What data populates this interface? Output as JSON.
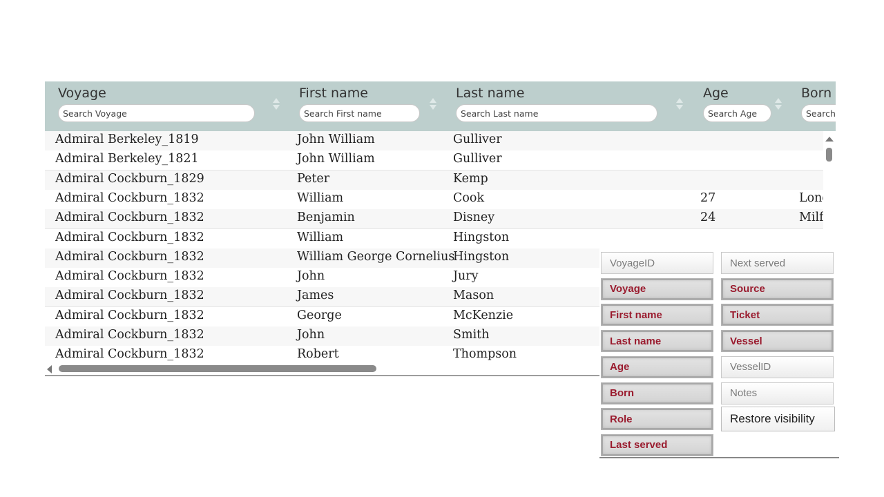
{
  "table": {
    "columns": [
      {
        "label": "Voyage",
        "placeholder": "Search Voyage"
      },
      {
        "label": "First name",
        "placeholder": "Search First name"
      },
      {
        "label": "Last name",
        "placeholder": "Search Last name"
      },
      {
        "label": "Age",
        "placeholder": "Search Age"
      },
      {
        "label": "Born",
        "placeholder": "Search Born"
      }
    ],
    "rows": [
      {
        "voyage": "Admiral Berkeley_1819",
        "first": "John William",
        "last": "Gulliver",
        "age": "",
        "born": ""
      },
      {
        "voyage": "Admiral Berkeley_1821",
        "first": "John William",
        "last": "Gulliver",
        "age": "",
        "born": ""
      },
      {
        "voyage": "Admiral Cockburn_1829",
        "first": "Peter",
        "last": "Kemp",
        "age": "",
        "born": ""
      },
      {
        "voyage": "Admiral Cockburn_1832",
        "first": "William",
        "last": "Cook",
        "age": "27",
        "born": "London"
      },
      {
        "voyage": "Admiral Cockburn_1832",
        "first": "Benjamin",
        "last": "Disney",
        "age": "24",
        "born": "Milford"
      },
      {
        "voyage": "Admiral Cockburn_1832",
        "first": "William",
        "last": "Hingston",
        "age": "",
        "born": ""
      },
      {
        "voyage": "Admiral Cockburn_1832",
        "first": "William George Cornelius",
        "last": "Hingston",
        "age": "",
        "born": ""
      },
      {
        "voyage": "Admiral Cockburn_1832",
        "first": "John",
        "last": "Jury",
        "age": "",
        "born": ""
      },
      {
        "voyage": "Admiral Cockburn_1832",
        "first": "James",
        "last": "Mason",
        "age": "",
        "born": ""
      },
      {
        "voyage": "Admiral Cockburn_1832",
        "first": "George",
        "last": "McKenzie",
        "age": "",
        "born": ""
      },
      {
        "voyage": "Admiral Cockburn_1832",
        "first": "John",
        "last": "Smith",
        "age": "",
        "born": ""
      },
      {
        "voyage": "Admiral Cockburn_1832",
        "first": "Robert",
        "last": "Thompson",
        "age": "",
        "born": ""
      }
    ]
  },
  "column_visibility": {
    "buttons": [
      {
        "label": "VoyageID",
        "active": false
      },
      {
        "label": "Next served",
        "active": false
      },
      {
        "label": "Voyage",
        "active": true
      },
      {
        "label": "Source",
        "active": true
      },
      {
        "label": "First name",
        "active": true
      },
      {
        "label": "Ticket",
        "active": true
      },
      {
        "label": "Last name",
        "active": true
      },
      {
        "label": "Vessel",
        "active": true
      },
      {
        "label": "Age",
        "active": true
      },
      {
        "label": "VesselID",
        "active": false
      },
      {
        "label": "Born",
        "active": true
      },
      {
        "label": "Notes",
        "active": false
      },
      {
        "label": "Role",
        "active": true
      },
      {
        "label": "Restore visibility",
        "active": null
      },
      {
        "label": "Last served",
        "active": true
      }
    ]
  },
  "colors": {
    "header_bg": "#bdcfcd",
    "active_text": "#9a1b2e",
    "inactive_text": "#7b7b7b"
  }
}
